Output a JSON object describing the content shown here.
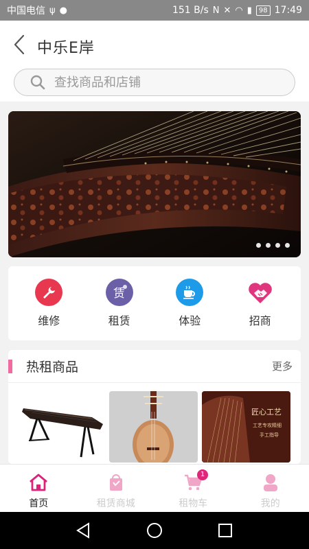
{
  "status_bar": {
    "carrier": "中国电信",
    "speed": "151 B/s",
    "battery": "98",
    "time": "17:49"
  },
  "header": {
    "title": "中乐E岸"
  },
  "search": {
    "placeholder": "查找商品和店铺"
  },
  "banner": {
    "slide_count": 4
  },
  "categories": [
    {
      "label": "维修",
      "icon": "wrench-icon",
      "color": "#e8384f"
    },
    {
      "label": "租赁",
      "icon": "rent-icon",
      "color": "#6b5fa8"
    },
    {
      "label": "体验",
      "icon": "coffee-cup-icon",
      "color": "#1e9be8"
    },
    {
      "label": "招商",
      "icon": "handshake-heart-icon",
      "color": "#e0367e"
    }
  ],
  "hot": {
    "title": "热租商品",
    "more": "更多",
    "products": [
      {
        "alt": "guzheng-on-stand"
      },
      {
        "alt": "pipa"
      },
      {
        "alt": "guzheng-craft",
        "overlay_title": "匠心工艺",
        "overlay_sub1": "工艺专攻精细",
        "overlay_sub2": "手工指导"
      }
    ]
  },
  "bottom_nav": [
    {
      "label": "首页",
      "icon": "home-icon",
      "active": true
    },
    {
      "label": "租赁商城",
      "icon": "shopping-bag-icon",
      "active": false
    },
    {
      "label": "租物车",
      "icon": "cart-icon",
      "active": false,
      "badge": "1"
    },
    {
      "label": "我的",
      "icon": "user-icon",
      "active": false
    }
  ],
  "colors": {
    "accent": "#e0287a",
    "hot_bar": "#f06ba0"
  }
}
